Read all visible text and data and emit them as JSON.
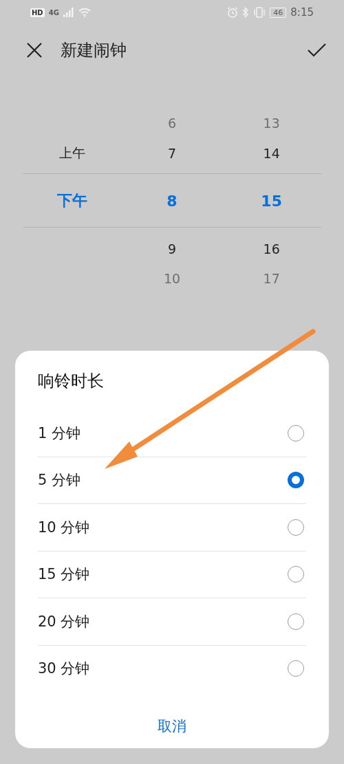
{
  "status_bar": {
    "hd": "HD",
    "network": "4G",
    "battery": "46",
    "time": "8:15"
  },
  "header": {
    "title": "新建闹钟"
  },
  "picker": {
    "columns": [
      {
        "items": [
          {
            "label": "上午",
            "selected": false
          },
          {
            "label": "下午",
            "selected": true
          }
        ]
      },
      {
        "items": [
          {
            "label": "6",
            "selected": false
          },
          {
            "label": "7",
            "selected": false
          },
          {
            "label": "8",
            "selected": true
          },
          {
            "label": "9",
            "selected": false
          },
          {
            "label": "10",
            "selected": false
          }
        ]
      },
      {
        "items": [
          {
            "label": "13",
            "selected": false
          },
          {
            "label": "14",
            "selected": false
          },
          {
            "label": "15",
            "selected": true
          },
          {
            "label": "16",
            "selected": false
          },
          {
            "label": "17",
            "selected": false
          }
        ]
      }
    ]
  },
  "dialog": {
    "title": "响铃时长",
    "options": [
      {
        "label": "1 分钟",
        "selected": false
      },
      {
        "label": "5 分钟",
        "selected": true
      },
      {
        "label": "10 分钟",
        "selected": false
      },
      {
        "label": "15 分钟",
        "selected": false
      },
      {
        "label": "20 分钟",
        "selected": false
      },
      {
        "label": "30 分钟",
        "selected": false
      }
    ],
    "cancel": "取消"
  }
}
